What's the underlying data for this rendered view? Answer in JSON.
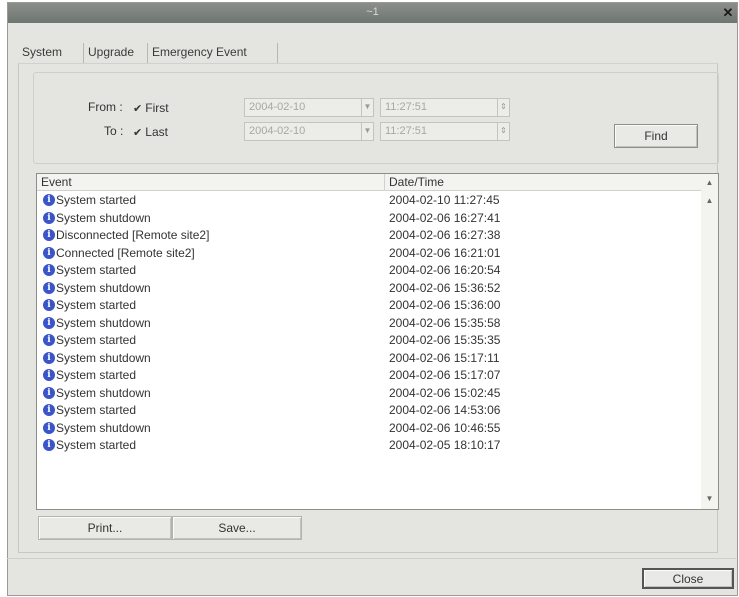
{
  "window": {
    "title": "~1",
    "close_glyph": "✕"
  },
  "tabs": [
    {
      "label": "System",
      "active": true
    },
    {
      "label": "Upgrade",
      "active": false
    },
    {
      "label": "Emergency Event",
      "active": false
    }
  ],
  "filter": {
    "from_label": "From :",
    "from_check_label": "First",
    "from_checked": true,
    "from_date": "2004-02-10",
    "from_time": "11:27:51",
    "to_label": "To :",
    "to_check_label": "Last",
    "to_checked": true,
    "to_date": "2004-02-10",
    "to_time": "11:27:51",
    "check_glyph": "✔",
    "find_label": "Find"
  },
  "events": {
    "columns": {
      "event": "Event",
      "datetime": "Date/Time"
    },
    "rows": [
      {
        "event": "System started",
        "datetime": "2004-02-10 11:27:45"
      },
      {
        "event": "System shutdown",
        "datetime": "2004-02-06 16:27:41"
      },
      {
        "event": "Disconnected [Remote site2]",
        "datetime": "2004-02-06 16:27:38"
      },
      {
        "event": "Connected [Remote site2]",
        "datetime": "2004-02-06 16:21:01"
      },
      {
        "event": "System started",
        "datetime": "2004-02-06 16:20:54"
      },
      {
        "event": "System shutdown",
        "datetime": "2004-02-06 15:36:52"
      },
      {
        "event": "System started",
        "datetime": "2004-02-06 15:36:00"
      },
      {
        "event": "System shutdown",
        "datetime": "2004-02-06 15:35:58"
      },
      {
        "event": "System started",
        "datetime": "2004-02-06 15:35:35"
      },
      {
        "event": "System shutdown",
        "datetime": "2004-02-06 15:17:11"
      },
      {
        "event": "System started",
        "datetime": "2004-02-06 15:17:07"
      },
      {
        "event": "System shutdown",
        "datetime": "2004-02-06 15:02:45"
      },
      {
        "event": "System started",
        "datetime": "2004-02-06 14:53:06"
      },
      {
        "event": "System shutdown",
        "datetime": "2004-02-06 10:46:55"
      },
      {
        "event": "System started",
        "datetime": "2004-02-05 18:10:17"
      }
    ],
    "info_icon_glyph": "i"
  },
  "buttons": {
    "print_label": "Print...",
    "save_label": "Save...",
    "close_label": "Close"
  }
}
